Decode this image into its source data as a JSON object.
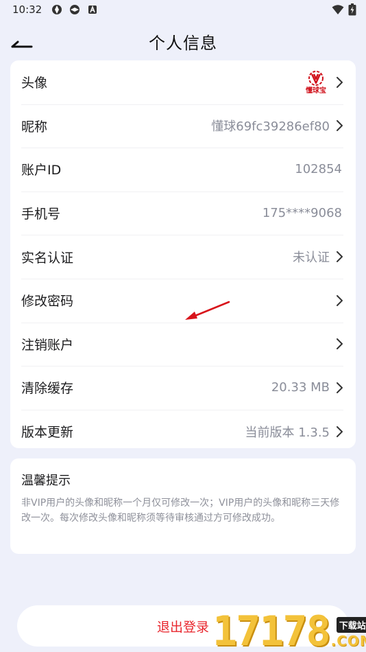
{
  "status_bar": {
    "time": "10:32"
  },
  "header": {
    "title": "个人信息"
  },
  "avatar": {
    "brand_text": "懂球宝"
  },
  "rows": [
    {
      "label": "头像",
      "value": ""
    },
    {
      "label": "昵称",
      "value": "懂球69fc39286ef80"
    },
    {
      "label": "账户ID",
      "value": "102854"
    },
    {
      "label": "手机号",
      "value": "175****9068"
    },
    {
      "label": "实名认证",
      "value": "未认证"
    },
    {
      "label": "修改密码",
      "value": ""
    },
    {
      "label": "注销账户",
      "value": ""
    },
    {
      "label": "清除缓存",
      "value": "20.33 MB"
    },
    {
      "label": "版本更新",
      "value": "当前版本 1.3.5"
    }
  ],
  "tips": {
    "title": "温馨提示",
    "text": "非VIP用户的头像和昵称一个月仅可修改一次；VIP用户的头像和昵称三天修改一次。每次修改头像和昵称须等待审核通过方可修改成功。"
  },
  "logout": {
    "label": "退出登录"
  },
  "watermark": {
    "digits": "17178",
    "tag": "下载站",
    "domain": ".COM"
  },
  "colors": {
    "accent_red": "#e8262d",
    "background": "#eef0fa",
    "value_gray": "#8a8d99"
  }
}
